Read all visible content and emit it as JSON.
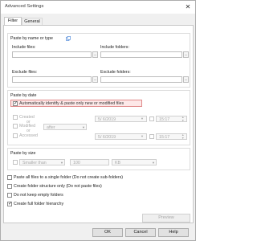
{
  "window": {
    "title": "Advanced Settings",
    "close_glyph": "✕"
  },
  "tabs": [
    {
      "label": "Filter",
      "active": true
    },
    {
      "label": "General",
      "active": false
    }
  ],
  "paste_by_name": {
    "heading": "Paste by name or type",
    "include_files_label": "Include files:",
    "include_folders_label": "Include folders:",
    "exclude_files_label": "Exclude files:",
    "exclude_folders_label": "Exclude folders:",
    "include_files_value": "",
    "include_folders_value": "",
    "exclude_files_value": "",
    "exclude_folders_value": "",
    "browse_label": "..."
  },
  "paste_by_date": {
    "heading": "Paste by date",
    "auto_identify_label": "Automatically identify & paste only new or modified files",
    "auto_identify_checked": true,
    "created_label": "Created",
    "or1": "or",
    "modified_label": "Modified",
    "or2": "or",
    "accessed_label": "Accessed",
    "condition_value": "after",
    "date1": "5/ 6/2019",
    "date2": "5/ 6/2019",
    "time1": "15:17",
    "time2": "15:17"
  },
  "paste_by_size": {
    "heading": "Paste by size",
    "comparison_value": "Smaller than",
    "size_value": "100",
    "unit_value": "KB"
  },
  "options": [
    {
      "label": "Paste all files to a single folder (Do not create sub-folders)",
      "checked": false
    },
    {
      "label": "Create folder structure only (Do not paste files)",
      "checked": false
    },
    {
      "label": "Do not keep empty folders",
      "checked": false
    },
    {
      "label": "Create full folder hierarchy",
      "checked": true
    }
  ],
  "preview_button": "Preview",
  "footer": {
    "ok": "OK",
    "cancel": "Cancel",
    "help": "Help"
  }
}
